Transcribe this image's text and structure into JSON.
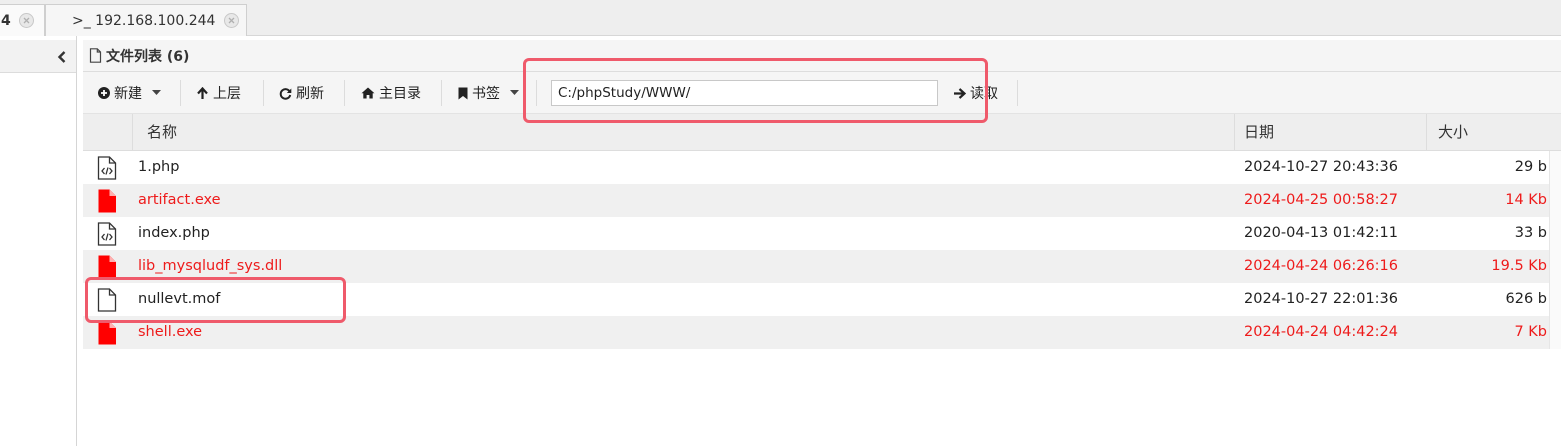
{
  "tabs": [
    {
      "label": "4",
      "closable": true
    },
    {
      "label": ">_ 192.168.100.244",
      "closable": true
    }
  ],
  "panel": {
    "title": "文件列表 (6)"
  },
  "toolbar": {
    "new_label": "新建",
    "up_label": "上层",
    "refresh_label": "刷新",
    "home_label": "主目录",
    "bookmark_label": "书签",
    "path_value": "C:/phpStudy/WWW/",
    "read_label": "读取"
  },
  "table": {
    "headers": {
      "name": "名称",
      "date": "日期",
      "size": "大小"
    },
    "rows": [
      {
        "icon": "php-file-icon",
        "name": "1.php",
        "date": "2024-10-27 20:43:36",
        "size": "29 b",
        "highlight": false
      },
      {
        "icon": "exe-file-icon",
        "name": "artifact.exe",
        "date": "2024-04-25 00:58:27",
        "size": "14 Kb",
        "highlight": true
      },
      {
        "icon": "php-file-icon",
        "name": "index.php",
        "date": "2020-04-13 01:42:11",
        "size": "33 b",
        "highlight": false
      },
      {
        "icon": "dll-file-icon",
        "name": "lib_mysqludf_sys.dll",
        "date": "2024-04-24 06:26:16",
        "size": "19.5 Kb",
        "highlight": true
      },
      {
        "icon": "blank-file-icon",
        "name": "nullevt.mof",
        "date": "2024-10-27 22:01:36",
        "size": "626 b",
        "highlight": false
      },
      {
        "icon": "exe-file-icon",
        "name": "shell.exe",
        "date": "2024-04-24 04:42:24",
        "size": "7 Kb",
        "highlight": true
      }
    ]
  },
  "colors": {
    "danger_text": "#ee1b1b",
    "annotation_box": "#ef5a6b"
  }
}
